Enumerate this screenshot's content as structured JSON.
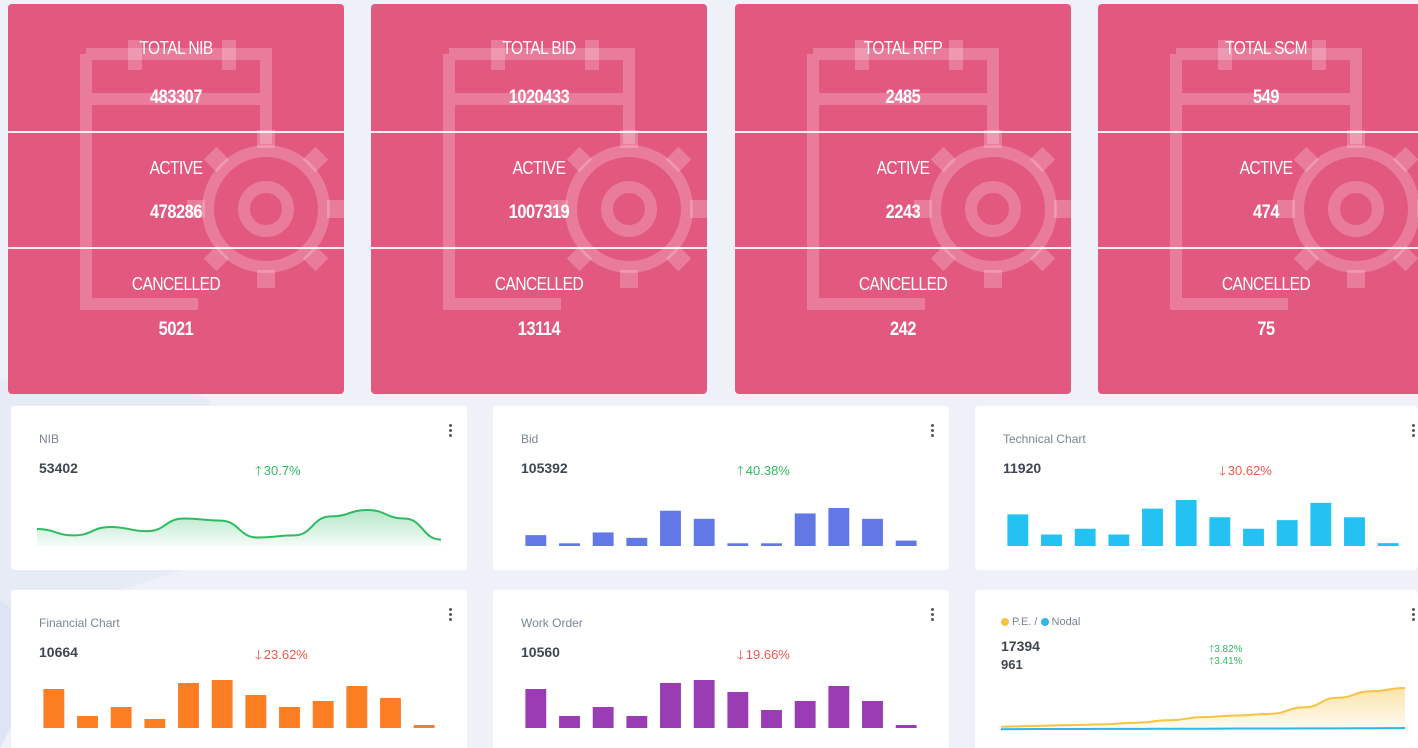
{
  "stat_cards": [
    {
      "total_label": "TOTAL NIB",
      "total": "483307",
      "active_label": "ACTIVE",
      "active": "478286",
      "cancelled_label": "CANCELLED",
      "cancelled": "5021"
    },
    {
      "total_label": "TOTAL BID",
      "total": "1020433",
      "active_label": "ACTIVE",
      "active": "1007319",
      "cancelled_label": "CANCELLED",
      "cancelled": "13114"
    },
    {
      "total_label": "TOTAL RFP",
      "total": "2485",
      "active_label": "ACTIVE",
      "active": "2243",
      "cancelled_label": "CANCELLED",
      "cancelled": "242"
    },
    {
      "total_label": "TOTAL SCM",
      "total": "549",
      "active_label": "ACTIVE",
      "active": "474",
      "cancelled_label": "CANCELLED",
      "cancelled": "75"
    }
  ],
  "mini_cards": {
    "nib": {
      "title": "NIB",
      "value": "53402",
      "change": "30.7%",
      "trend": "up",
      "arrow": "🡑",
      "color": "#2dbb62"
    },
    "bid": {
      "title": "Bid",
      "value": "105392",
      "change": "40.38%",
      "trend": "up",
      "arrow": "🡑",
      "color": "#6278e6"
    },
    "technical": {
      "title": "Technical Chart",
      "value": "11920",
      "change": "30.62%",
      "trend": "down",
      "arrow": "🡓",
      "color": "#23c2f2"
    },
    "financial": {
      "title": "Financial Chart",
      "value": "10664",
      "change": "23.62%",
      "trend": "down",
      "arrow": "🡓",
      "color": "#fb7f22"
    },
    "work_order": {
      "title": "Work Order",
      "value": "10560",
      "change": "19.66%",
      "trend": "down",
      "arrow": "🡓",
      "color": "#9a3db4"
    },
    "pe_nodal": {
      "legend_pe": "P.E.",
      "legend_sep": " / ",
      "legend_nodal": "Nodal",
      "pe_color": "#f7c342",
      "nodal_color": "#2fb7e6",
      "pe_value": "17394",
      "nodal_value": "961",
      "pe_change": "3.82%",
      "nodal_change": "3.41%",
      "arrow": "🡑"
    }
  },
  "chart_data": [
    {
      "type": "area",
      "name": "NIB",
      "values": [
        8,
        5,
        9,
        7,
        13,
        12,
        4,
        5,
        14,
        17,
        13,
        3
      ]
    },
    {
      "type": "bar",
      "name": "Bid",
      "values": [
        4,
        1,
        5,
        3,
        13,
        10,
        1,
        1,
        12,
        14,
        10,
        2
      ]
    },
    {
      "type": "bar",
      "name": "Technical Chart",
      "values": [
        11,
        4,
        6,
        4,
        13,
        16,
        10,
        6,
        9,
        15,
        10,
        1
      ]
    },
    {
      "type": "bar",
      "name": "Financial Chart",
      "values": [
        13,
        4,
        7,
        3,
        15,
        16,
        11,
        7,
        9,
        14,
        10,
        1
      ]
    },
    {
      "type": "bar",
      "name": "Work Order",
      "values": [
        13,
        4,
        7,
        4,
        15,
        16,
        12,
        6,
        9,
        14,
        9,
        1
      ]
    },
    {
      "type": "area",
      "name": "P.E. / Nodal",
      "series": [
        {
          "name": "P.E.",
          "values": [
            2,
            2.5,
            3,
            3.5,
            4.5,
            6,
            8,
            9,
            10,
            14,
            20,
            24,
            26
          ]
        },
        {
          "name": "Nodal",
          "values": [
            0.5,
            0.6,
            0.6,
            0.7,
            0.7,
            0.8,
            0.8,
            0.9,
            0.9,
            1,
            1,
            1.1,
            1.2
          ]
        }
      ]
    }
  ]
}
